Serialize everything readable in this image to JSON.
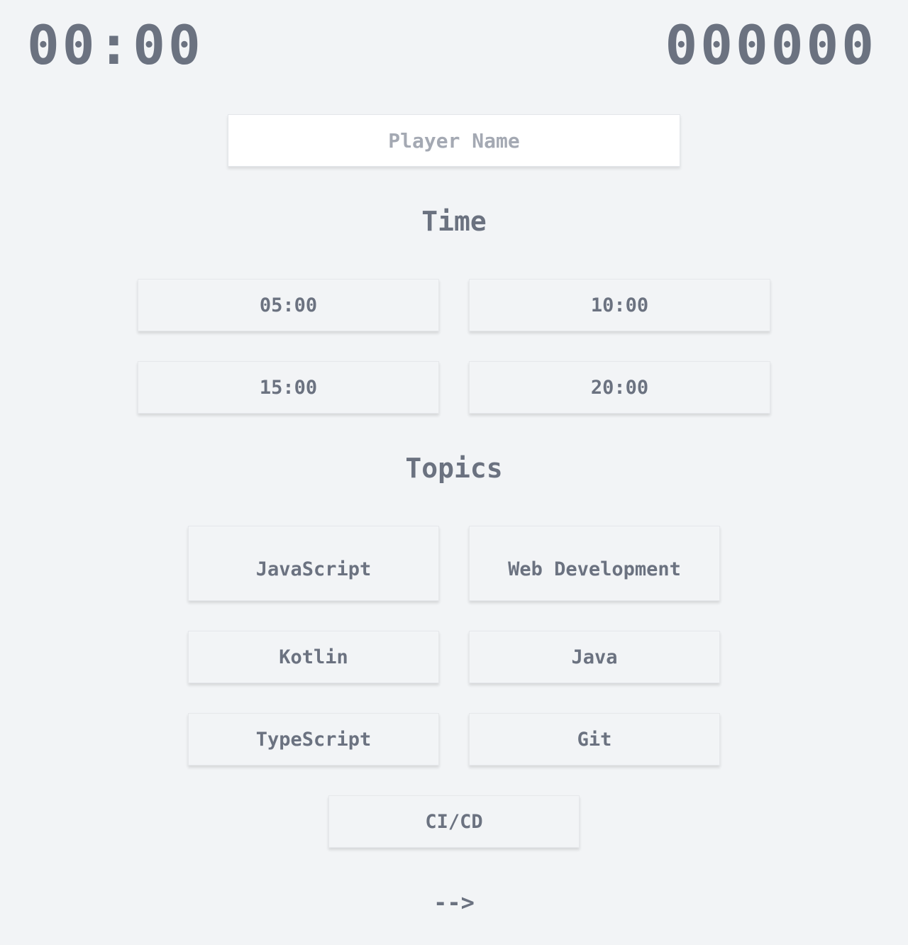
{
  "hud": {
    "timer": "00:00",
    "score": "000000"
  },
  "player_name": {
    "placeholder": "Player Name",
    "value": ""
  },
  "time_section": {
    "title": "Time",
    "options": [
      "05:00",
      "10:00",
      "15:00",
      "20:00"
    ]
  },
  "topics_section": {
    "title": "Topics",
    "options": [
      "JavaScript",
      "Web Development",
      "Kotlin",
      "Java",
      "TypeScript",
      "Git",
      "CI/CD"
    ]
  },
  "next": {
    "label": "-->"
  }
}
